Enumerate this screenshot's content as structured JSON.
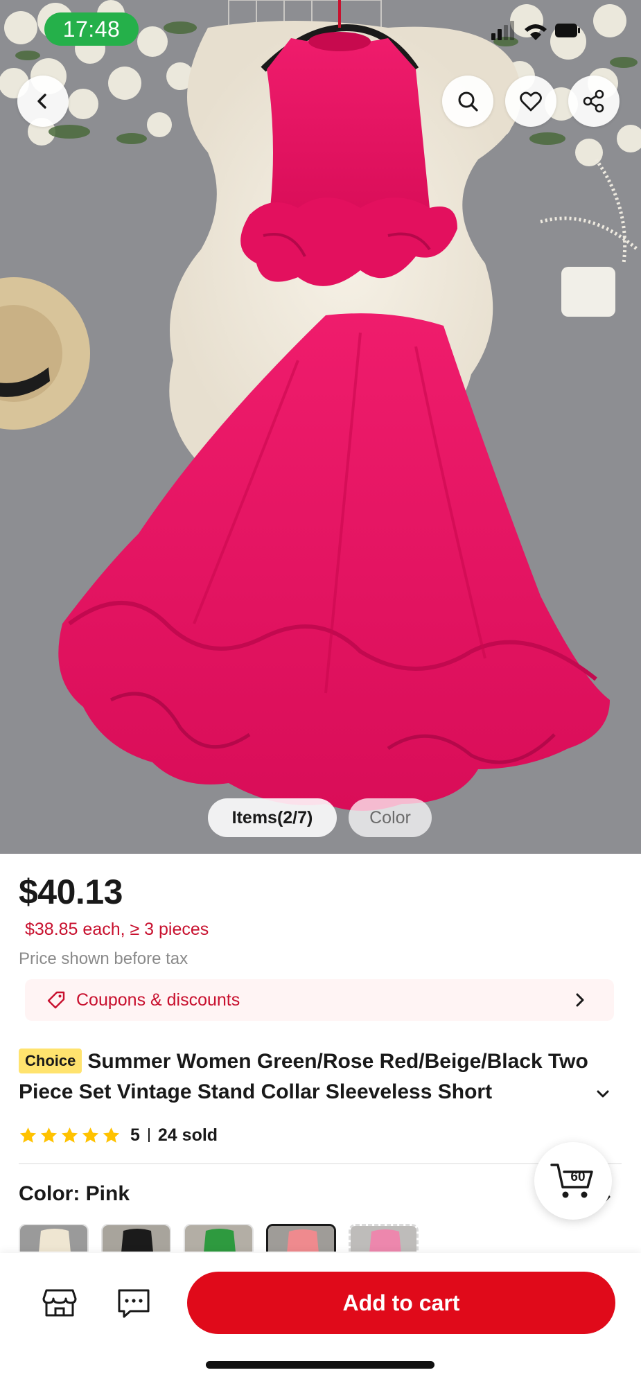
{
  "status_bar": {
    "time": "17:48"
  },
  "gallery": {
    "items_tab": "Items(2/7)",
    "color_tab": "Color"
  },
  "product": {
    "price": "$40.13",
    "bulk_price": "$38.85 each, ≥ 3 pieces",
    "tax_note": "Price shown before tax",
    "coupons_label": "Coupons & discounts",
    "badge": "Choice",
    "title": "Summer Women Green/Rose Red/Beige/Black Two Piece Set Vintage Stand Collar Sleeveless Short",
    "rating": "5",
    "sold": "24 sold",
    "stars_filled": 5,
    "color_label": "Color: Pink",
    "swatch_colors": [
      "beige",
      "black",
      "green",
      "pink",
      "rose-red"
    ],
    "selected_swatch": "pink"
  },
  "cart": {
    "count": "60"
  },
  "bottom_bar": {
    "add_to_cart": "Add to cart"
  },
  "colors": {
    "accent_red": "#e00a1a",
    "price_red": "#c8102e",
    "choice_yellow": "#ffe36e",
    "status_green": "#25b04a",
    "dress_pink": "#e8125f"
  }
}
